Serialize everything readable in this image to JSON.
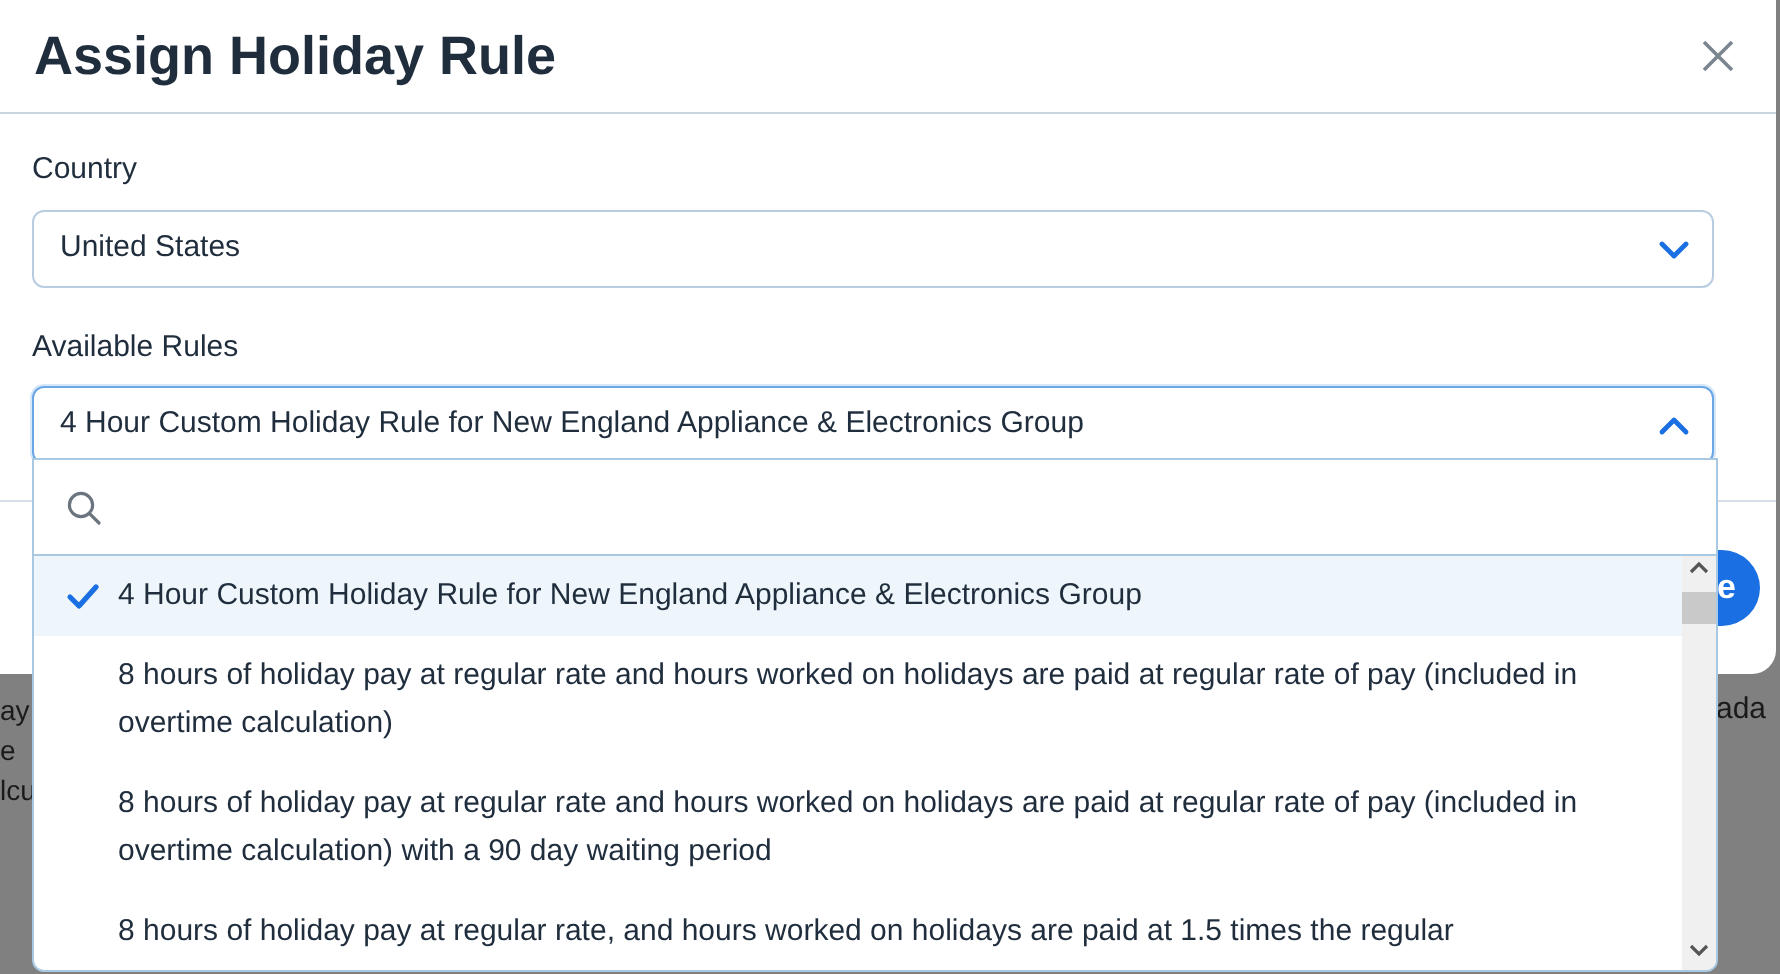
{
  "modal": {
    "title": "Assign Holiday Rule",
    "fields": [
      {
        "label": "Country",
        "value": "United States",
        "expanded": false
      },
      {
        "label": "Available Rules",
        "value": "4 Hour Custom Holiday Rule for New England Appliance & Electronics Group",
        "expanded": true
      }
    ],
    "footer_button": "e"
  },
  "dropdown": {
    "options": [
      {
        "text": "4 Hour Custom Holiday Rule for New England Appliance & Electronics Group",
        "selected": true
      },
      {
        "text": "8 hours of holiday pay at regular rate and hours worked on holidays are paid at regular rate of pay (included in overtime calculation)",
        "selected": false
      },
      {
        "text": "8 hours of holiday pay at regular rate and hours worked on holidays are paid at regular rate of pay (included in overtime calculation) with a 90 day waiting period",
        "selected": false
      },
      {
        "text": "8 hours of holiday pay at regular rate, and hours worked on holidays are paid at 1.5 times the regular",
        "selected": false
      }
    ]
  },
  "background": {
    "left_lines": [
      "ay",
      "e",
      "lcu"
    ],
    "right_text": "ada"
  }
}
